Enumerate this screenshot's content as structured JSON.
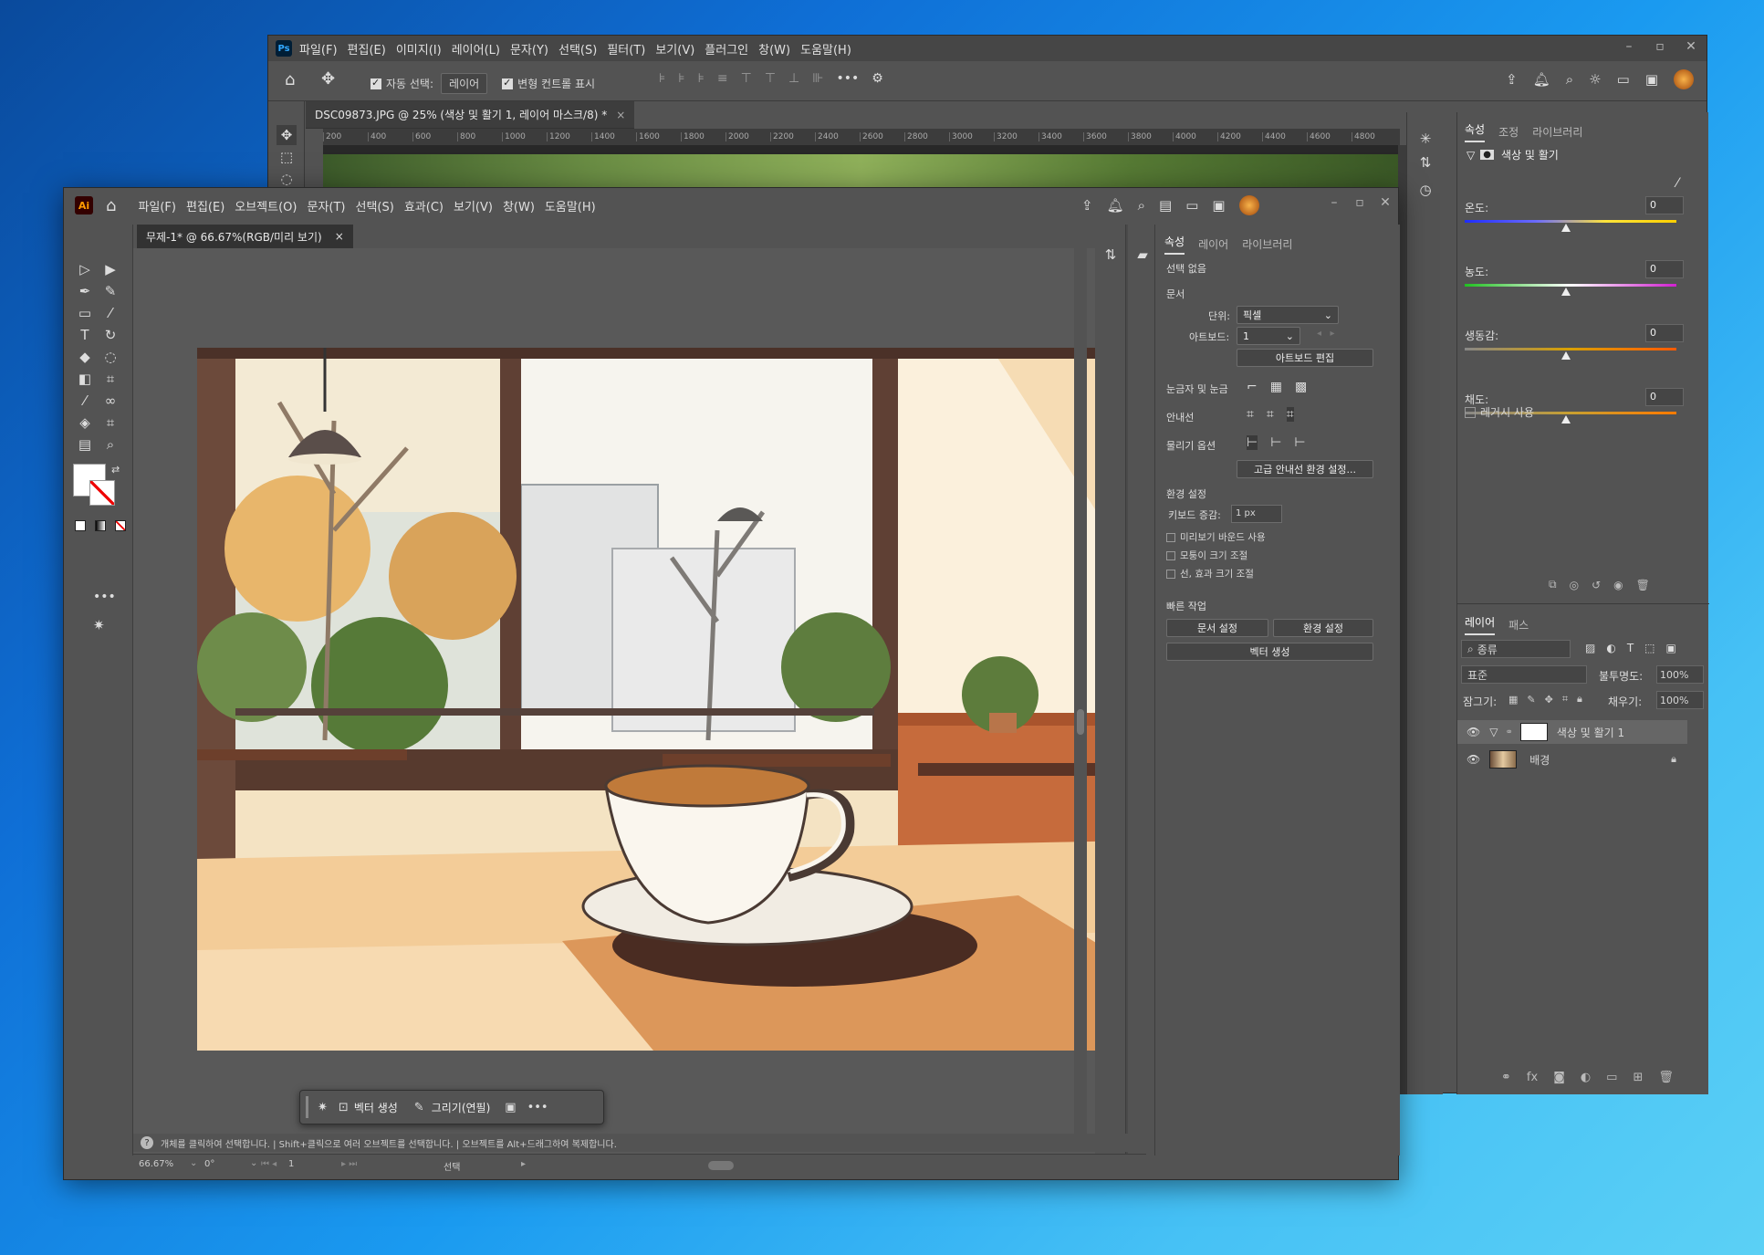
{
  "ps": {
    "logo": "Ps",
    "menu": [
      "파일(F)",
      "편집(E)",
      "이미지(I)",
      "레이어(L)",
      "문자(Y)",
      "선택(S)",
      "필터(T)",
      "보기(V)",
      "플러그인",
      "창(W)",
      "도움말(H)"
    ],
    "options": {
      "auto_select_label": "자동 선택:",
      "auto_select_value": "레이어",
      "transform_label": "변형 컨트롤 표시"
    },
    "doc_tab": "DSC09873.JPG @ 25% (색상 및 활기 1, 레이어 마스크/8) *",
    "ruler_ticks": [
      "200",
      "400",
      "600",
      "800",
      "1000",
      "1200",
      "1400",
      "1600",
      "1800",
      "2000",
      "2200",
      "2400",
      "2600",
      "2800",
      "3000",
      "3200",
      "3400",
      "3600",
      "3800",
      "4000",
      "4200",
      "4400",
      "4600",
      "4800"
    ],
    "props_tabs": [
      "속성",
      "조정",
      "라이브러리"
    ],
    "props_title": "색상 및 활기",
    "sliders": [
      {
        "label": "온도:",
        "value": "0"
      },
      {
        "label": "농도:",
        "value": "0"
      },
      {
        "label": "생동감:",
        "value": "0"
      },
      {
        "label": "채도:",
        "value": "0"
      }
    ],
    "legacy_label": "레거시 사용",
    "layers_tabs": [
      "레이어",
      "패스"
    ],
    "filter_value": "종류",
    "blend_mode": "표준",
    "opacity_label": "불투명도:",
    "opacity_value": "100%",
    "lock_label": "잠그기:",
    "fill_label": "채우기:",
    "fill_value": "100%",
    "layers": [
      {
        "name": "색상 및 활기 1"
      },
      {
        "name": "배경"
      }
    ]
  },
  "ai": {
    "logo": "Ai",
    "menu": [
      "파일(F)",
      "편집(E)",
      "오브젝트(O)",
      "문자(T)",
      "선택(S)",
      "효과(C)",
      "보기(V)",
      "창(W)",
      "도움말(H)"
    ],
    "doc_tab": "무제-1* @ 66.67%(RGB/미리 보기)",
    "panel_tabs": [
      "속성",
      "레이어",
      "라이브러리"
    ],
    "no_selection": "선택 없음",
    "document_header": "문서",
    "unit_label": "단위:",
    "unit_value": "픽셀",
    "artboard_label": "아트보드:",
    "artboard_value": "1",
    "edit_artboard": "아트보드 편집",
    "rulers_label": "눈금자 및 눈금",
    "guides_label": "안내선",
    "snap_label": "물리기 옵션",
    "advanced_guides": "고급 안내선 환경 설정...",
    "prefs_header": "환경 설정",
    "keyboard_inc_label": "키보드 증감:",
    "keyboard_inc_value": "1 px",
    "checkboxes": [
      "미리보기 바운드 사용",
      "모퉁이 크기 조절",
      "선, 효과 크기 조절"
    ],
    "quick_actions": "빠른 작업",
    "doc_setup": "문서 설정",
    "prefs_btn": "환경 설정",
    "vectorize": "벡터 생성",
    "ctx_vector": "벡터 생성",
    "ctx_draw": "그리기(연필)",
    "status_text": "개체를 클릭하여 선택합니다.  |  Shift+클릭으로 여러 오브젝트를 선택합니다.  |  오브젝트를 Alt+드래그하여 복제합니다.",
    "zoom": "66.67%",
    "rotation": "0°",
    "page": "1",
    "mode": "선택"
  }
}
